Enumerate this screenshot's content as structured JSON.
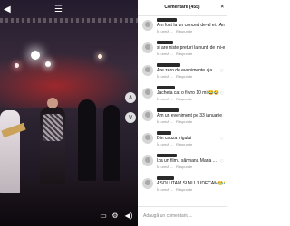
{
  "video": {
    "top_icons": {
      "list": "☰",
      "back": "◀"
    },
    "controls": {
      "subtitles": "▭",
      "settings": "⚙",
      "volume": "◀)"
    },
    "nav": {
      "up": "∧",
      "down": "∨"
    }
  },
  "comments_panel": {
    "title": "Comentarii (455)",
    "close": "×",
    "items": [
      {
        "text": "Am fost la un concert de-al ei.. Am fost dezamagita",
        "meta_time": "În urmă ...",
        "meta_reply": "Răspunde"
      },
      {
        "text": "si are niste preturi la nunti de mi-e si rușine",
        "meta_time": "În urmă ...",
        "meta_reply": "Răspunde"
      },
      {
        "text": "Are zero de evenimente aja",
        "meta_time": "În urmă ...",
        "meta_reply": "Răspunde"
      },
      {
        "text": "Jacheta cat o fi vro 10 mii😂😂",
        "meta_time": "În urmă ...",
        "meta_reply": "Răspunde"
      },
      {
        "text": "Am un eveniment pe 33 ianuarie",
        "meta_time": "În urmă ...",
        "meta_reply": "Răspunde"
      },
      {
        "text": "Din cauza frigului",
        "meta_time": "În urmă ...",
        "meta_reply": "Răspunde"
      },
      {
        "text": "Iza un film.. sărmana Maria ...",
        "meta_time": "În urmă ...",
        "meta_reply": "Răspunde"
      },
      {
        "text": "ASOLUTAM SI NU JUDECAM😂😂",
        "meta_time": "În urmă ...",
        "meta_reply": "Răspunde"
      }
    ],
    "input_placeholder": "Adaugă un comentariu..."
  }
}
